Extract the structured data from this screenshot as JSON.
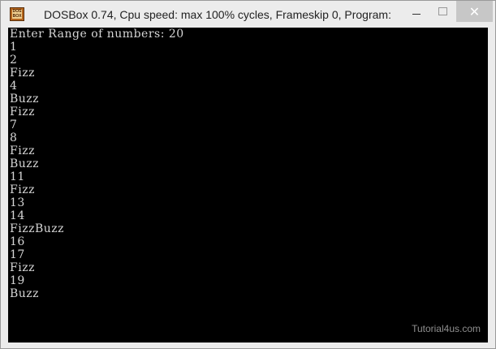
{
  "window": {
    "title": "DOSBox 0.74, Cpu speed: max 100% cycles, Frameskip  0, Program:",
    "icon_text": "DOS BOX",
    "controls": {
      "minimize": "minimize-icon",
      "maximize": "maximize-icon",
      "close": "✕"
    }
  },
  "console": {
    "lines": [
      "Enter Range of numbers: 20",
      "1",
      "2",
      "Fizz",
      "4",
      "Buzz",
      "Fizz",
      "7",
      "8",
      "Fizz",
      "Buzz",
      "11",
      "Fizz",
      "13",
      "14",
      "FizzBuzz",
      "16",
      "17",
      "Fizz",
      "19",
      "Buzz"
    ]
  },
  "watermark": "Tutorial4us.com",
  "colors": {
    "console_bg": "#000000",
    "console_text": "#d6d6d6",
    "titlebar_bg": "#ececec",
    "close_button_bg": "#c7c7c7"
  }
}
